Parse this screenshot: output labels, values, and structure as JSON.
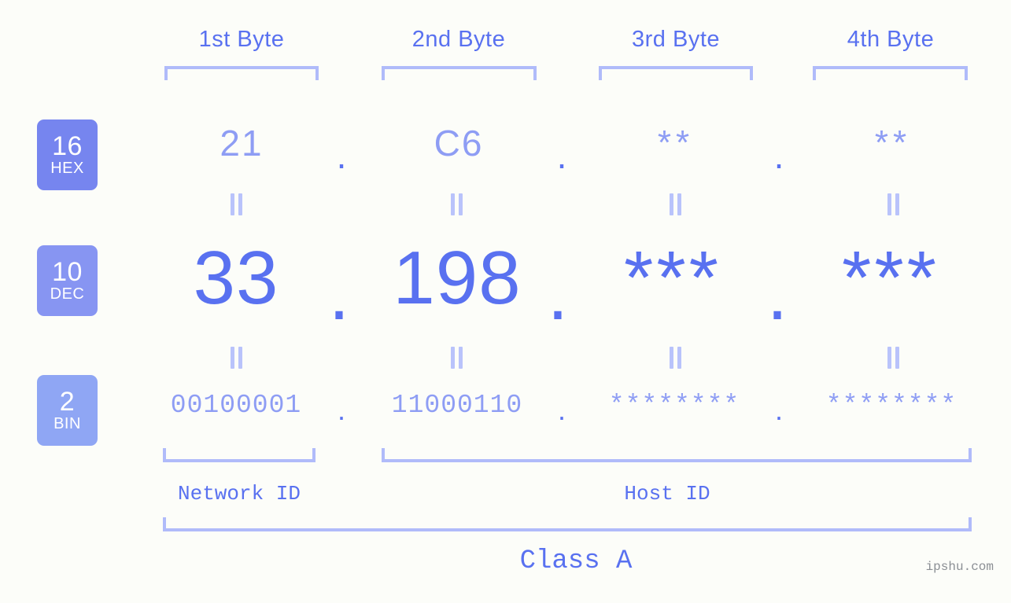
{
  "meta": {
    "background": "#fcfdf9",
    "accent": "#5971f0",
    "accent_light": "#8e9df4",
    "bracket": "#b0bbfa",
    "connector": "#b9c3fb"
  },
  "header": {
    "byte_labels": [
      "1st Byte",
      "2nd Byte",
      "3rd Byte",
      "4th Byte"
    ]
  },
  "bases": [
    {
      "number": "16",
      "name": "HEX",
      "color": "#7685ef"
    },
    {
      "number": "10",
      "name": "DEC",
      "color": "#8795f2"
    },
    {
      "number": "2",
      "name": "BIN",
      "color": "#8fa6f4"
    }
  ],
  "rows": {
    "hex": {
      "values": [
        "21",
        "C6",
        "**",
        "**"
      ],
      "separator": "."
    },
    "dec": {
      "values": [
        "33",
        "198",
        "***",
        "***"
      ],
      "separator": "."
    },
    "bin": {
      "values": [
        "00100001",
        "11000110",
        "********",
        "********"
      ],
      "separator": "."
    }
  },
  "footer": {
    "network_id_label": "Network ID",
    "host_id_label": "Host ID",
    "class_label": "Class A",
    "watermark": "ipshu.com"
  }
}
